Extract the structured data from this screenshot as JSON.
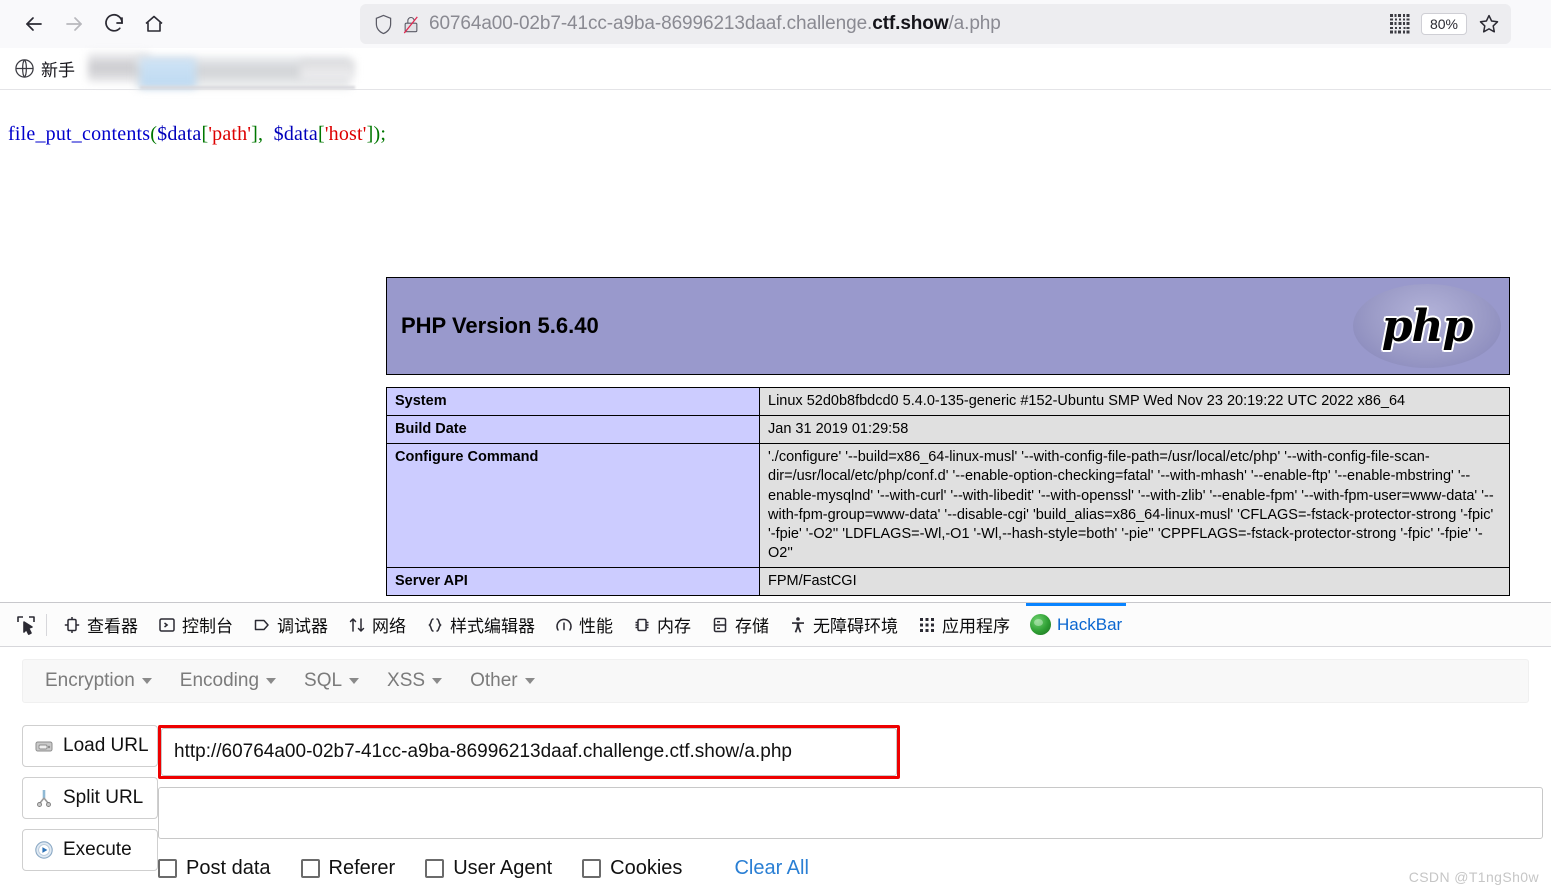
{
  "browser": {
    "nav": {
      "back_icon": "arrow-left-icon",
      "forward_icon": "arrow-right-icon",
      "reload_icon": "reload-icon",
      "home_icon": "home-icon"
    },
    "urlbar": {
      "shield_icon": "shield-icon",
      "lock_broken_icon": "lock-broken-icon",
      "url_prefix": "60764a00-02b7-41cc-a9ba-86996213daaf.challenge.",
      "url_host": "ctf.show",
      "url_suffix": "/a.php",
      "full_url": "60764a00-02b7-41cc-a9ba-86996213daaf.challenge.ctf.show/a.php",
      "qr_icon": "qr-code-icon",
      "zoom_level": "80%",
      "bookmark_icon": "star-icon"
    },
    "tabs": {
      "first_tab_icon": "globe-icon",
      "first_tab_label": "新手"
    }
  },
  "page": {
    "code": {
      "fn": "file_put_contents",
      "open_paren": "(",
      "var1": "$data",
      "lb1": "[",
      "str1": "'path'",
      "rb1": "]",
      "comma": ",",
      "var2": "$data",
      "lb2": "[",
      "str2": "'host'",
      "rb2": "]",
      "close": ");"
    },
    "phpinfo": {
      "version_title": "PHP Version 5.6.40",
      "logo_text": "php",
      "rows": [
        {
          "key": "System",
          "value": "Linux 52d0b8fbdcd0 5.4.0-135-generic #152-Ubuntu SMP Wed Nov 23 20:19:22 UTC 2022 x86_64"
        },
        {
          "key": "Build Date",
          "value": "Jan 31 2019 01:29:58"
        },
        {
          "key": "Configure Command",
          "value": "'./configure'  '--build=x86_64-linux-musl' '--with-config-file-path=/usr/local/etc/php' '--with-config-file-scan-dir=/usr/local/etc/php/conf.d' '--enable-option-checking=fatal' '--with-mhash' '--enable-ftp' '--enable-mbstring' '--enable-mysqlnd' '--with-curl' '--with-libedit' '--with-openssl' '--with-zlib' '--enable-fpm' '--with-fpm-user=www-data' '--with-fpm-group=www-data' '--disable-cgi' 'build_alias=x86_64-linux-musl' 'CFLAGS=-fstack-protector-strong '-fpic' '-fpie' '-O2'' 'LDFLAGS=-Wl,-O1 '-Wl,--hash-style=both' '-pie'' 'CPPFLAGS=-fstack-protector-strong '-fpic' '-fpie' '-O2''"
        },
        {
          "key": "Server API",
          "value": "FPM/FastCGI"
        }
      ]
    }
  },
  "devtools": {
    "picker_icon": "element-picker-icon",
    "tabs": [
      {
        "label": "查看器",
        "icon": "inspector-icon",
        "active": false
      },
      {
        "label": "控制台",
        "icon": "console-icon",
        "active": false
      },
      {
        "label": "调试器",
        "icon": "debugger-icon",
        "active": false
      },
      {
        "label": "网络",
        "icon": "network-icon",
        "active": false
      },
      {
        "label": "样式编辑器",
        "icon": "style-editor-icon",
        "active": false
      },
      {
        "label": "性能",
        "icon": "performance-icon",
        "active": false
      },
      {
        "label": "内存",
        "icon": "memory-icon",
        "active": false
      },
      {
        "label": "存储",
        "icon": "storage-icon",
        "active": false
      },
      {
        "label": "无障碍环境",
        "icon": "accessibility-icon",
        "active": false
      },
      {
        "label": "应用程序",
        "icon": "application-icon",
        "active": false
      },
      {
        "label": "HackBar",
        "icon": "hackbar-icon",
        "active": true
      }
    ]
  },
  "hackbar": {
    "menus": [
      {
        "label": "Encryption"
      },
      {
        "label": "Encoding"
      },
      {
        "label": "SQL"
      },
      {
        "label": "XSS"
      },
      {
        "label": "Other"
      }
    ],
    "buttons": [
      {
        "label": "Load URL",
        "icon": "load-url-icon"
      },
      {
        "label": "Split URL",
        "icon": "split-url-icon"
      },
      {
        "label": "Execute",
        "icon": "execute-icon"
      }
    ],
    "url_value": "http://60764a00-02b7-41cc-a9ba-86996213daaf.challenge.ctf.show/a.php",
    "url_placeholder": "",
    "postdata_value": "",
    "postdata_placeholder": "",
    "checkboxes": [
      {
        "label": "Post data",
        "checked": false
      },
      {
        "label": "Referer",
        "checked": false
      },
      {
        "label": "User Agent",
        "checked": false
      },
      {
        "label": "Cookies",
        "checked": false
      }
    ],
    "clear_all_label": "Clear All",
    "highlight_color": "#ee0000"
  },
  "watermark": "CSDN @T1ngSh0w"
}
